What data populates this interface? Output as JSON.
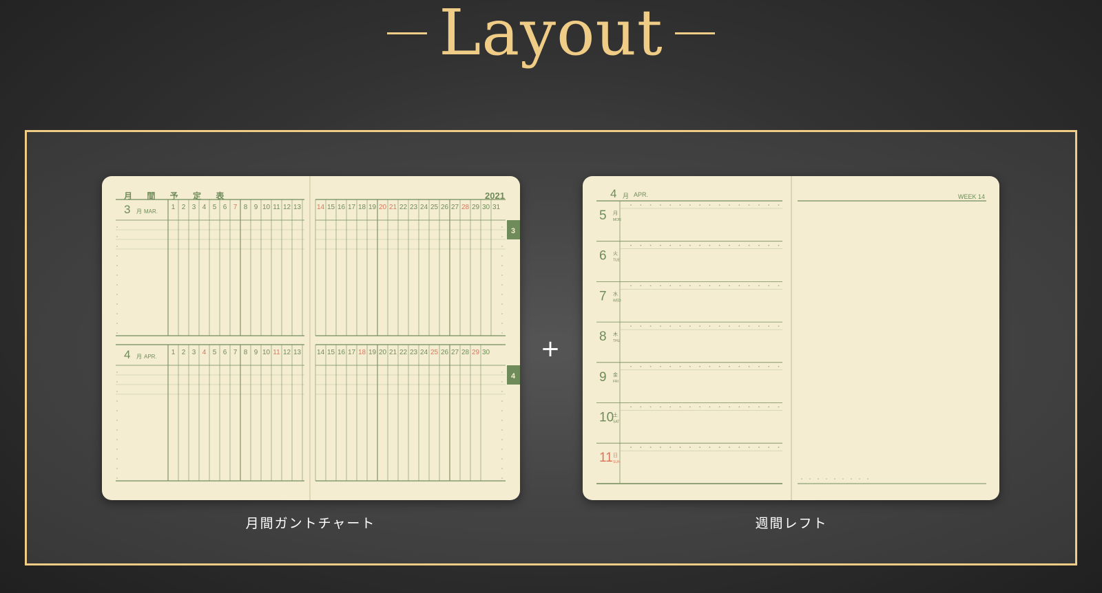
{
  "header": {
    "title": "Layout"
  },
  "colors": {
    "accent": "#f0cd86",
    "paper": "#f5edd1",
    "ink_green": "#6f8b5a",
    "ink_red": "#d9775a"
  },
  "plus_sign": "+",
  "monthly": {
    "caption": "月間ガントチャート",
    "heading": "月 間 予 定 表",
    "year": "2021",
    "blocks": [
      {
        "month": "3",
        "month_jp": "月",
        "month_en": "MAR.",
        "tab": "3",
        "days_left": [
          "1",
          "2",
          "3",
          "4",
          "5",
          "6",
          "7",
          "8",
          "9",
          "10",
          "11",
          "12",
          "13"
        ],
        "days_right": [
          "14",
          "15",
          "16",
          "17",
          "18",
          "19",
          "20",
          "21",
          "22",
          "23",
          "24",
          "25",
          "26",
          "27",
          "28",
          "29",
          "30",
          "31"
        ],
        "red_left": [
          "7"
        ],
        "red_right": [
          "14",
          "20",
          "21",
          "28"
        ]
      },
      {
        "month": "4",
        "month_jp": "月",
        "month_en": "APR.",
        "tab": "4",
        "days_left": [
          "1",
          "2",
          "3",
          "4",
          "5",
          "6",
          "7",
          "8",
          "9",
          "10",
          "11",
          "12",
          "13"
        ],
        "days_right": [
          "14",
          "15",
          "16",
          "17",
          "18",
          "19",
          "20",
          "21",
          "22",
          "23",
          "24",
          "25",
          "26",
          "27",
          "28",
          "29",
          "30"
        ],
        "red_left": [
          "4",
          "11"
        ],
        "red_right": [
          "18",
          "25",
          "29"
        ]
      }
    ]
  },
  "weekly": {
    "caption": "週間レフト",
    "month": "4",
    "month_jp": "月",
    "month_en": "APR.",
    "week_label": "WEEK 14",
    "days": [
      {
        "date": "5",
        "jp": "月",
        "en": "MON",
        "red": false
      },
      {
        "date": "6",
        "jp": "火",
        "en": "TUE",
        "red": false
      },
      {
        "date": "7",
        "jp": "水",
        "en": "WED",
        "red": false
      },
      {
        "date": "8",
        "jp": "木",
        "en": "THU",
        "red": false
      },
      {
        "date": "9",
        "jp": "金",
        "en": "FRI",
        "red": false
      },
      {
        "date": "10",
        "jp": "土",
        "en": "SAT",
        "red": false
      },
      {
        "date": "11",
        "jp": "日",
        "en": "SUN",
        "red": true
      }
    ]
  }
}
